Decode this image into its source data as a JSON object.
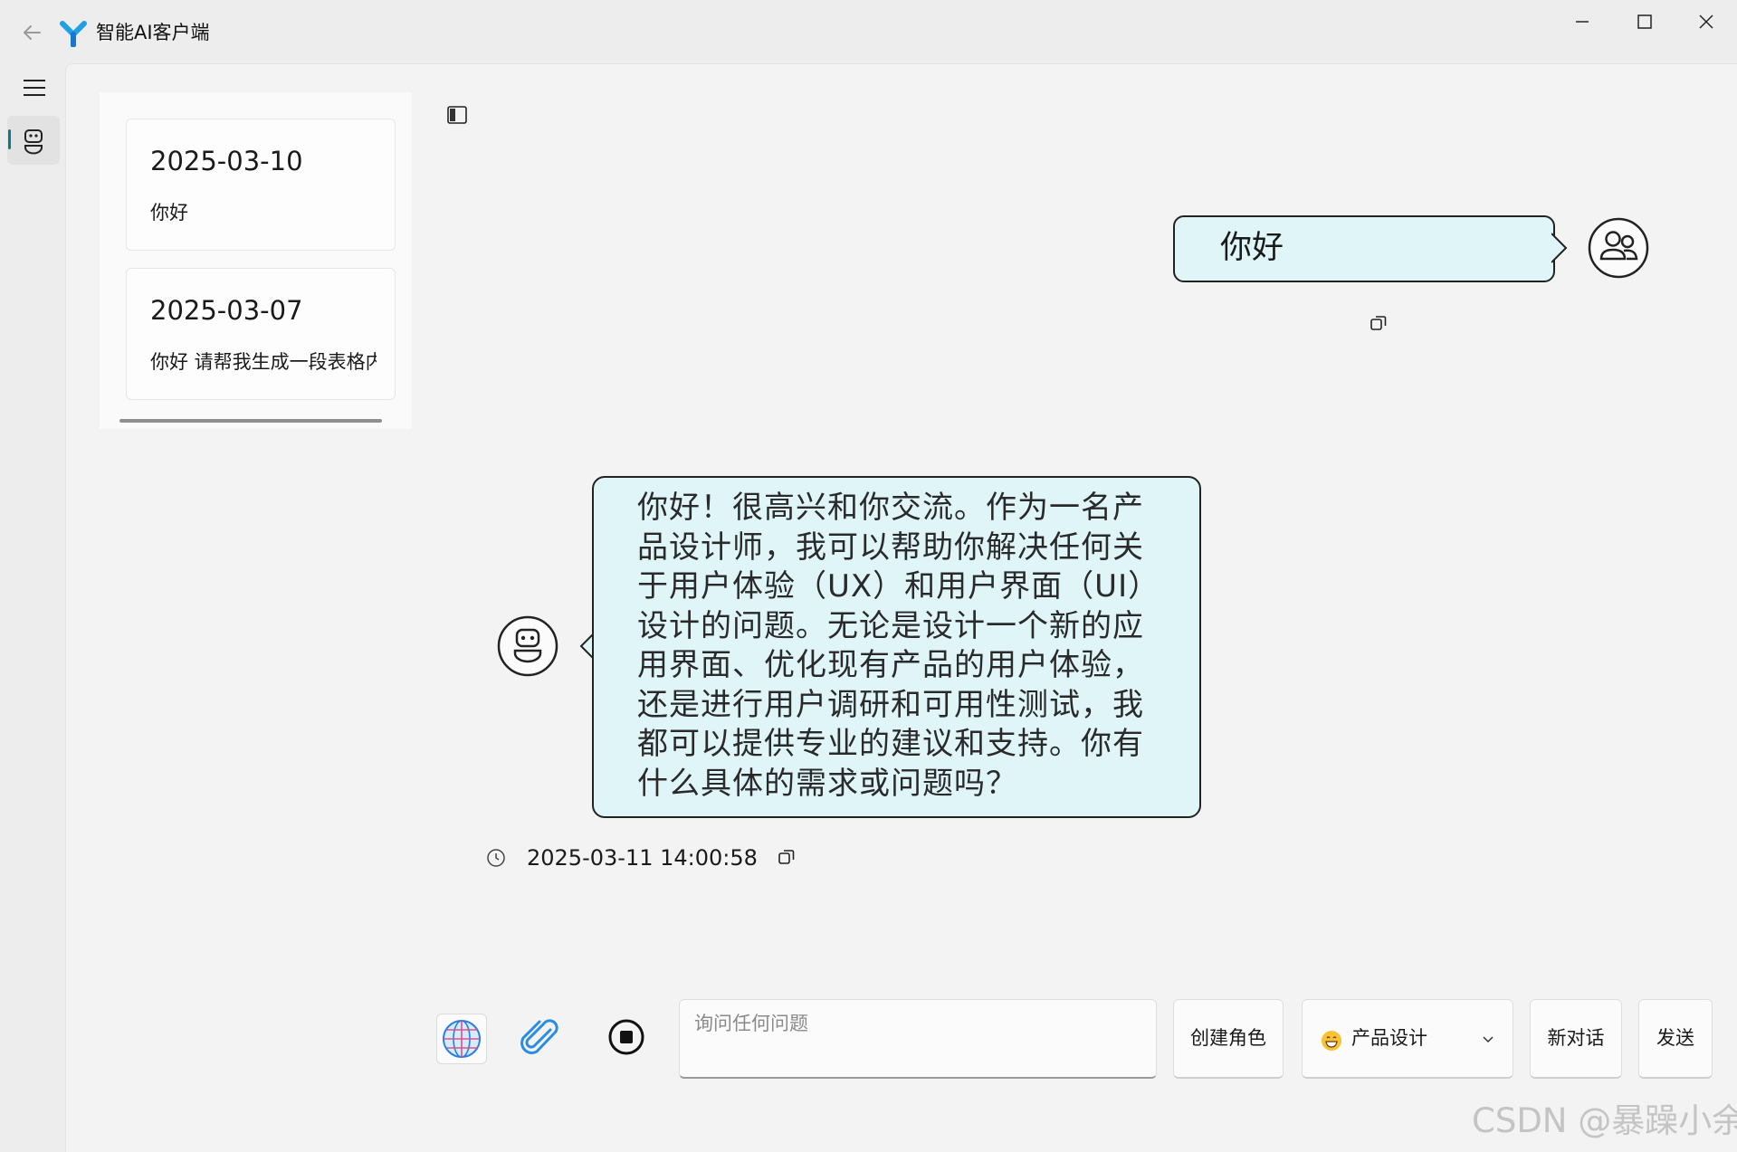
{
  "window": {
    "title": "智能AI客户端",
    "accent_color": "#0d7a84"
  },
  "history": [
    {
      "date": "2025-03-10",
      "preview": "你好"
    },
    {
      "date": "2025-03-07",
      "preview": "你好 请帮我生成一段表格内容"
    }
  ],
  "chat": {
    "user_message": "你好",
    "bot_message": "你好！很高兴和你交流。作为一名产品设计师，我可以帮助你解决任何关于用户体验（UX）和用户界面（UI）设计的问题。无论是设计一个新的应用界面、优化现有产品的用户体验，还是进行用户调研和可用性测试，我都可以提供专业的建议和支持。你有什么具体的需求或问题吗？",
    "bot_time": "2025-03-11 14:00:58",
    "bubble_color": "#dff5f8"
  },
  "input": {
    "placeholder": "询问任何问题",
    "value": ""
  },
  "buttons": {
    "create_role": "创建角色",
    "role_selected": "产品设计",
    "new_chat": "新对话",
    "send": "发送"
  },
  "watermark": "CSDN @暴躁小余",
  "icons": [
    "back-arrow-icon",
    "app-logo-icon",
    "minimize-icon",
    "maximize-icon",
    "close-icon",
    "hamburger-menu-icon",
    "robot-icon",
    "panel-toggle-icon",
    "user-group-icon",
    "copy-icon",
    "clock-icon",
    "globe-icon",
    "paperclip-icon",
    "stop-icon",
    "grin-emoji-icon",
    "chevron-down-icon"
  ]
}
